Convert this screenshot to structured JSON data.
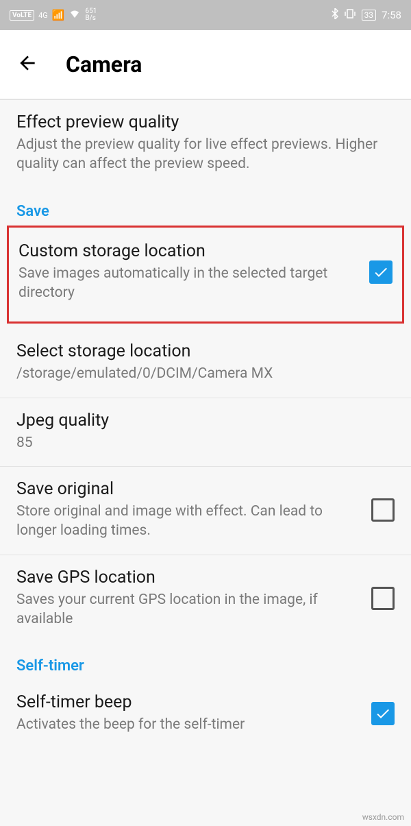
{
  "statusBar": {
    "volte": "VoLTE",
    "network": "4G",
    "speed": "651",
    "speedUnit": "B/s",
    "battery": "33",
    "time": "7:58"
  },
  "header": {
    "title": "Camera"
  },
  "settings": {
    "effectPreview": {
      "title": "Effect preview quality",
      "subtitle": "Adjust the preview quality for live effect previews. Higher quality can affect the preview speed."
    },
    "saveSection": "Save",
    "customStorage": {
      "title": "Custom storage location",
      "subtitle": "Save images automatically in the selected target directory",
      "checked": true
    },
    "selectStorage": {
      "title": "Select storage location",
      "subtitle": "/storage/emulated/0/DCIM/Camera MX"
    },
    "jpegQuality": {
      "title": "Jpeg quality",
      "subtitle": "85"
    },
    "saveOriginal": {
      "title": "Save original",
      "subtitle": "Store original and image with effect. Can lead to longer loading times.",
      "checked": false
    },
    "saveGps": {
      "title": "Save GPS location",
      "subtitle": "Saves your current GPS location in the image, if available",
      "checked": false
    },
    "selfTimerSection": "Self-timer",
    "selfTimerBeep": {
      "title": "Self-timer beep",
      "subtitle": "Activates the beep for the self-timer",
      "checked": true
    }
  },
  "watermark": "wsxdn.com"
}
